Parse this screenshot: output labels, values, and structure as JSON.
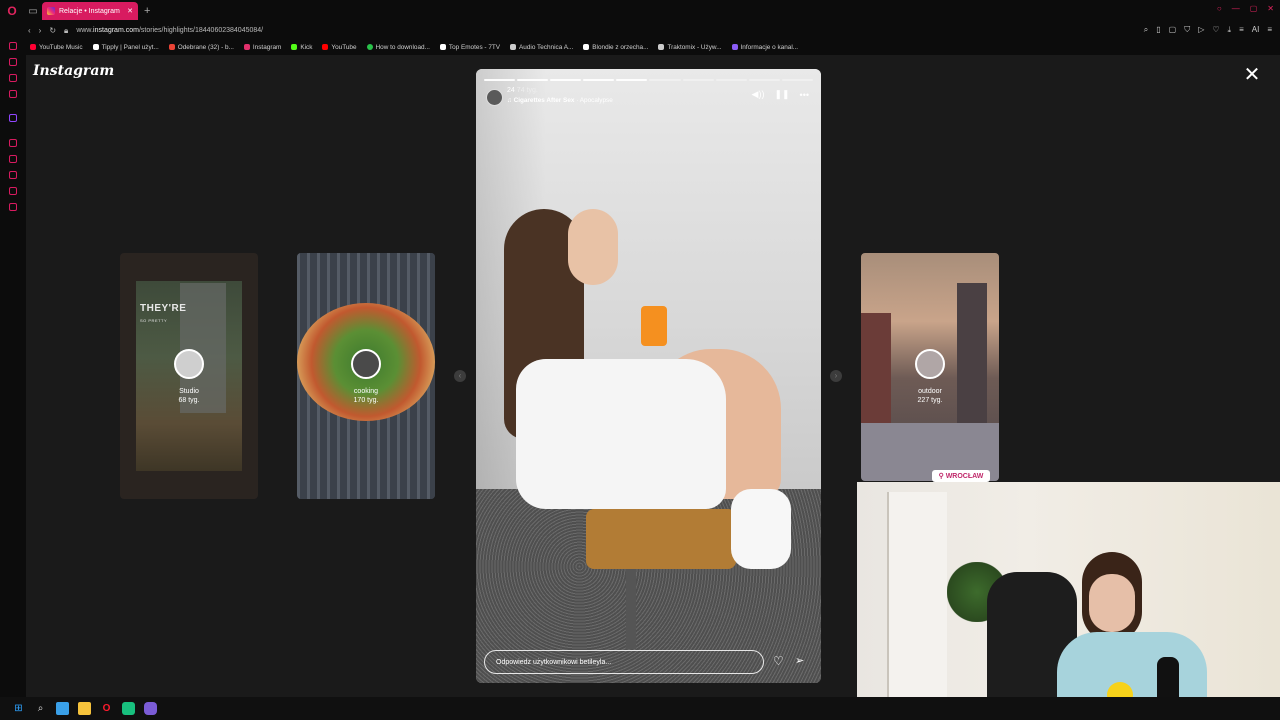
{
  "browser": {
    "tab_title": "Relacje • Instagram",
    "new_tab": "+",
    "url_prefix": "www.",
    "url_domain": "instagram.com",
    "url_path": "/stories/highlights/18440602384045084/",
    "bookmarks": [
      {
        "label": "YouTube Music",
        "color": "#ff0033"
      },
      {
        "label": "Tipply | Panel użyt...",
        "color": "#ffffff"
      },
      {
        "label": "Odebrane (32) - b...",
        "color": "#ea4335"
      },
      {
        "label": "Instagram",
        "color": "#e1306c"
      },
      {
        "label": "Kick",
        "color": "#53fc18"
      },
      {
        "label": "YouTube",
        "color": "#ff0000"
      },
      {
        "label": "How to download...",
        "color": "#29c24a"
      },
      {
        "label": "Top Emotes - 7TV",
        "color": "#ffffff"
      },
      {
        "label": "Audio Technica A...",
        "color": "#cccccc"
      },
      {
        "label": "Blondie z orzecha...",
        "color": "#ffffff"
      },
      {
        "label": "Traktomix - Używ...",
        "color": "#cccccc"
      },
      {
        "label": "Informacje o kanal...",
        "color": "#8b5cf6"
      }
    ],
    "addr_right_text": "AI"
  },
  "instagram": {
    "logo": "Instagram",
    "close_symbol": "✕",
    "prev_symbol": "‹",
    "next_symbol": "›",
    "cards": [
      {
        "title": "Studio",
        "age": "68 tyg.",
        "poster_line1": "THEY'RE",
        "poster_line2": "SO PRETTY"
      },
      {
        "title": "cooking",
        "age": "170 tyg."
      },
      {
        "title": "outdoor",
        "age": "227 tyg.",
        "badge": "WROCŁAW"
      }
    ],
    "story": {
      "progress_total": 10,
      "progress_done": 5,
      "user": "24",
      "age": "74 tyg.",
      "song_title": "Cigarettes After Sex",
      "song_sep": " · ",
      "song_name": "Apocalypse",
      "reply_placeholder": "Odpowiedz użytkownikowi betileyla..."
    }
  }
}
